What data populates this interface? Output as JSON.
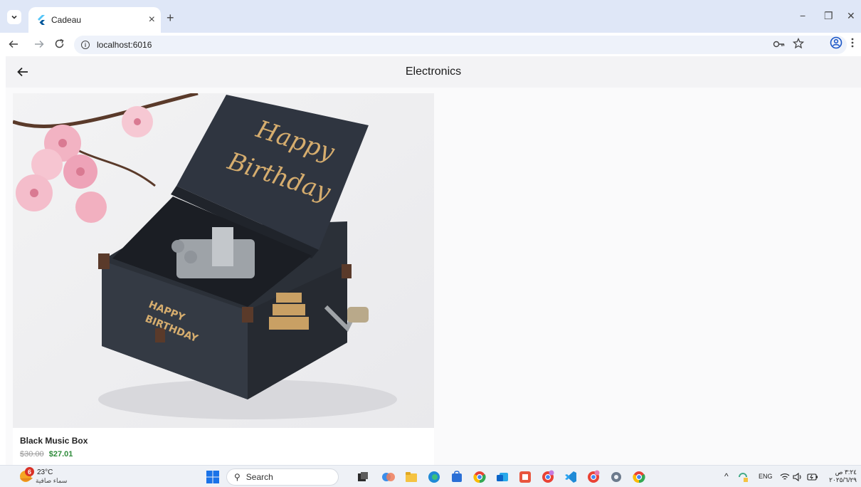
{
  "browser": {
    "tab_title": "Cadeau",
    "tab_close": "×",
    "new_tab": "+",
    "url": "localhost:6016",
    "window_controls": {
      "minimize": "−",
      "restore": "❐",
      "close": "✕"
    },
    "icons": [
      "back-icon",
      "forward-icon",
      "reload-icon",
      "site-info-icon",
      "password-key-icon",
      "bookmark-star-icon",
      "profile-icon",
      "menu-icon"
    ]
  },
  "app": {
    "title": "Electronics",
    "back_icon": "arrow-left-icon",
    "product": {
      "name": "Black Music Box",
      "old_price": "$30.00",
      "price": "$27.01",
      "image_text": [
        "Happy",
        "Birthday",
        "HAPPY",
        "BIRTHDAY"
      ]
    },
    "colors": {
      "price_green": "#2e8b3a",
      "appbar_bg": "#f3f3f5",
      "tabstrip_bg": "#dfe7f7"
    }
  },
  "taskbar": {
    "weather_badge": "6",
    "temperature": "23°C",
    "weather_desc": "سماء صافية",
    "search_label": "Search",
    "tray_lang": "ENG",
    "tray_caret": "^",
    "time": "٣:٢٤ ص",
    "date": "٢٠٢٥/٦/٢٩"
  }
}
